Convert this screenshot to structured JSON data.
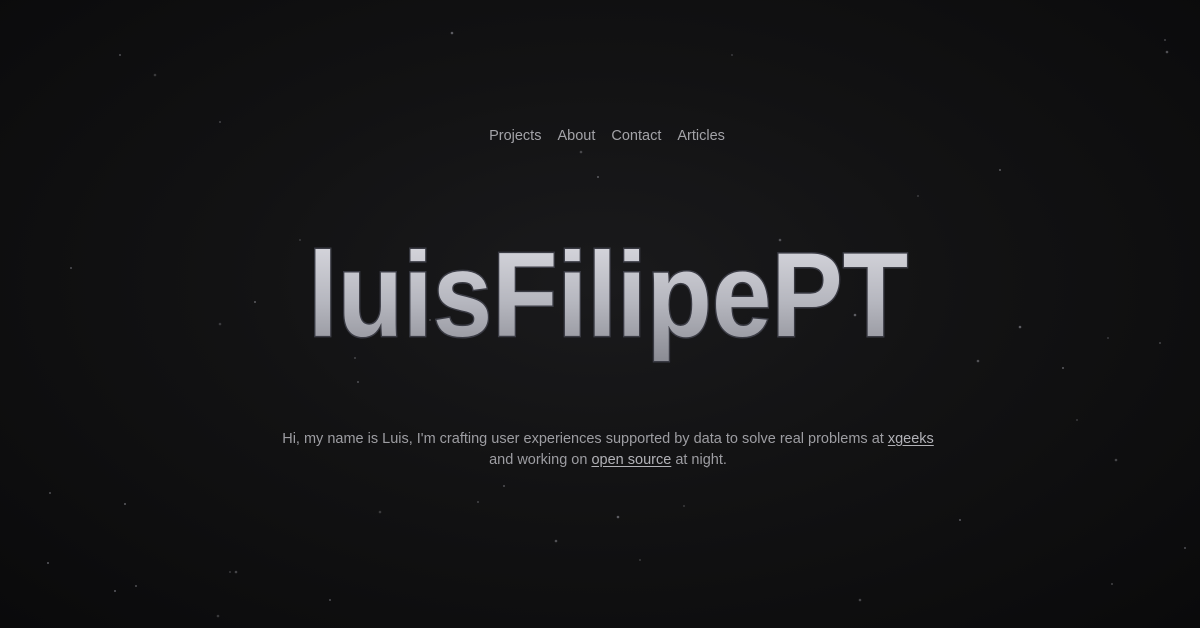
{
  "nav": {
    "items": [
      {
        "label": "Projects"
      },
      {
        "label": "About"
      },
      {
        "label": "Contact"
      },
      {
        "label": "Articles"
      }
    ]
  },
  "hero": {
    "title": "luisFilipePT"
  },
  "tagline": {
    "line1_prefix": "Hi, my name is Luis, I'm crafting user experiences supported by data to solve real problems at",
    "company_link": "xgeeks",
    "line2_prefix": "and working on",
    "open_source_link": "open source",
    "line2_suffix": "at night."
  },
  "colors": {
    "background": "#0b0b0c",
    "nav_text": "#a3a3a8",
    "title_fill_top": "#d8d8de",
    "title_fill_bottom": "#8f9098",
    "title_outline": "#3a3b44",
    "body_text": "#9d9da2"
  }
}
